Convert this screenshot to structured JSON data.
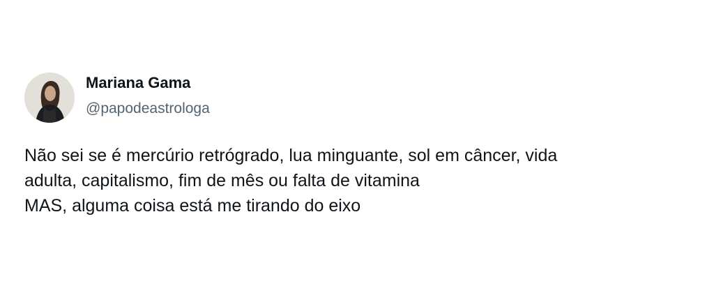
{
  "author": {
    "display_name": "Mariana Gama",
    "handle": "@papodeastrologa",
    "avatar_icon": "profile-photo-icon"
  },
  "tweet": {
    "lines": [
      "Não sei se é mercúrio retrógrado, lua minguante, sol em câncer, vida",
      "adulta, capitalismo, fim de mês ou falta de vitamina",
      "MAS, alguma coisa está me tirando do eixo"
    ]
  },
  "colors": {
    "background": "#ffffff",
    "text_primary": "#0f1419",
    "text_secondary": "#536471"
  }
}
